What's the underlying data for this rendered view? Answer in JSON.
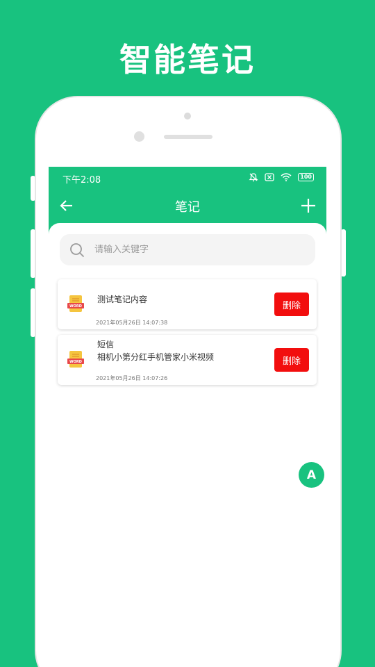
{
  "promo": {
    "title": "智能笔记"
  },
  "status": {
    "time": "下午2:08",
    "battery": "100"
  },
  "appbar": {
    "title": "笔记"
  },
  "search": {
    "placeholder": "请输入关键字"
  },
  "notes": [
    {
      "title": "",
      "content": "测试笔记内容",
      "date": "2021年05月26日 14:07:38",
      "delete_label": "删除",
      "icon_label": "WORD"
    },
    {
      "title": "短信",
      "content": "相机小第分红手机管家小米视频",
      "date": "2021年05月26日 14:07:26",
      "delete_label": "删除",
      "icon_label": "WORD"
    }
  ],
  "fab": {
    "label": "A"
  },
  "colors": {
    "brand": "#18c27f",
    "danger": "#f20e0e"
  },
  "icons": [
    "back-arrow-icon",
    "plus-icon",
    "search-icon",
    "word-file-icon",
    "mute-icon",
    "sim-icon",
    "wifi-icon",
    "battery-icon"
  ]
}
